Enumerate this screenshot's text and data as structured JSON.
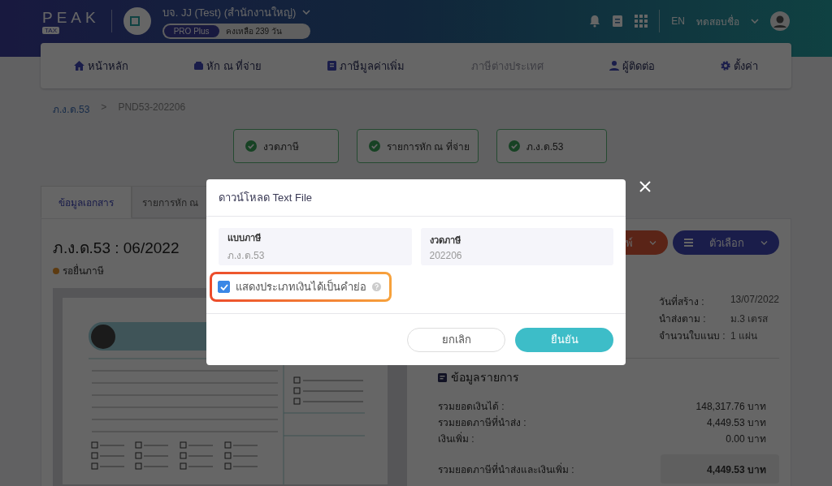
{
  "header": {
    "logo": "PEAK",
    "logo_badge": "TAX",
    "company": "บจ. JJ (Test) (สำนักงานใหญ่)",
    "plan": "PRO Plus",
    "remaining": "คงเหลือ 239 วัน",
    "language": "EN",
    "user": "ทดสอบชื่อ"
  },
  "nav": [
    {
      "label": "หน้าหลัก",
      "disabled": false
    },
    {
      "label": "หัก ณ ที่จ่าย",
      "disabled": false
    },
    {
      "label": "ภาษีมูลค่าเพิ่ม",
      "disabled": false
    },
    {
      "label": "ภาษีต่างประเทศ",
      "disabled": true
    },
    {
      "label": "ผู้ติดต่อ",
      "disabled": false
    },
    {
      "label": "ตั้งค่า",
      "disabled": false
    }
  ],
  "breadcrumb": {
    "link": "ภ.ง.ด.53",
    "separator": ">",
    "current": "PND53-202206"
  },
  "steps": [
    {
      "label": "งวดภาษี",
      "done": true
    },
    {
      "label": "รายการหัก ณ ที่จ่าย",
      "done": true
    },
    {
      "label": "ภ.ง.ด.53",
      "done": true
    }
  ],
  "tabs": [
    {
      "label": "ข้อมูลเอกสาร",
      "selected": true
    },
    {
      "label": "รายการหัก ณ",
      "selected": false
    }
  ],
  "document": {
    "title": "ภ.ง.ด.53 : 06/2022",
    "status": "รอยื่นภาษี"
  },
  "actions": [
    "พ์",
    "ตัวเลือก"
  ],
  "info": [
    {
      "label": "วันที่สร้าง :",
      "value": "13/07/2022"
    },
    {
      "label": "นำส่งตาม :",
      "value": "ม.3 เตรส"
    },
    {
      "label": "จำนวนใบแนบ :",
      "value": "1 แผ่น"
    }
  ],
  "summary": {
    "title": "ข้อมูลรายการ",
    "rows": [
      {
        "label": "รวมยอดเงินได้ :",
        "value": "148,317.76 บาท",
        "kind": "plain"
      },
      {
        "label": "รวมยอดภาษีที่นำส่ง :",
        "value": "4,449.53 บาท",
        "kind": "plain"
      },
      {
        "label": "เงินเพิ่ม :",
        "value": "0.00 บาท",
        "kind": "plain"
      },
      {
        "label": "รวมยอดภาษีที่นำส่งและเงินเพิ่ม :",
        "value": "4,449.53 บาท",
        "kind": "total"
      }
    ]
  },
  "modal": {
    "title": "ดาวน์โหลด Text File",
    "fields": [
      {
        "label": "แบบภาษี",
        "value": "ภ.ง.ด.53"
      },
      {
        "label": "งวดภาษี",
        "value": "202206"
      }
    ],
    "option": {
      "label": "แสดงประเภทเงินได้เป็นคำย่อ",
      "checked": true,
      "highlighted": true
    },
    "buttons": [
      {
        "label": "ยกเลิก",
        "kind": "secondary"
      },
      {
        "label": "ยืนยัน",
        "kind": "primary"
      }
    ]
  }
}
